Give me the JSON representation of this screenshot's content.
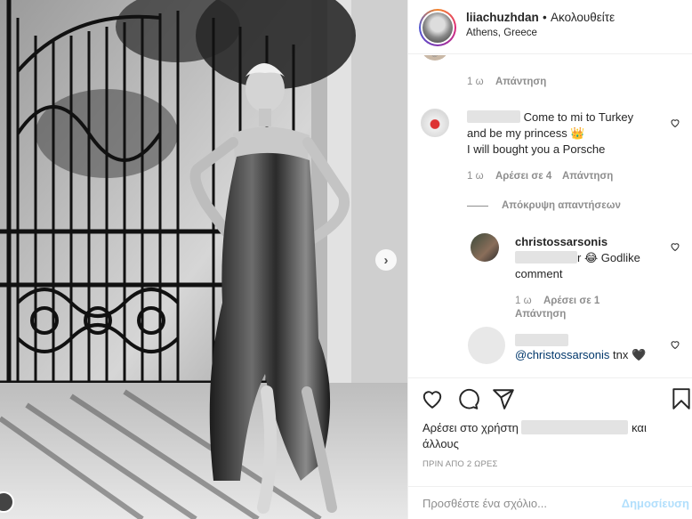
{
  "post": {
    "username": "liiachuzhdan",
    "dot": "•",
    "follow_label": "Ακολουθείτε",
    "location": "Athens, Greece"
  },
  "comments": {
    "top_reply": {
      "time": "1 ω",
      "reply_label": "Απάντηση"
    },
    "c1": {
      "text_line1": "Come to mi to Turkey",
      "text_line2": "and be my princess 👑",
      "text_line3": "I will bought you a Porsche",
      "time": "1 ω",
      "likes": "Αρέσει σε 4",
      "reply_label": "Απάντηση"
    },
    "hide_replies": "Απόκρυψη απαντήσεων",
    "r1": {
      "username": "christossarsonis",
      "text_suffix": "r 😂 Godlike",
      "text_line2": "comment",
      "time": "1 ω",
      "likes": "Αρέσει σε 1",
      "reply_label": "Απάντηση"
    },
    "r2": {
      "mention": "@christossarsonis",
      "text": "tnx 🖤"
    }
  },
  "actions": {
    "likes_prefix": "Αρέσει στο χρήστη",
    "likes_and": "και",
    "likes_others": "άλλους",
    "time_ago": "ΠΡΙΝ ΑΠΟ 2 ΩΡΕΣ"
  },
  "comment_box": {
    "placeholder": "Προσθέστε ένα σχόλιο...",
    "post_label": "Δημοσίευση"
  },
  "photo": {
    "next_icon": "chevron-right-icon"
  },
  "colors": {
    "muted": "#8e8e8e",
    "text": "#262626",
    "post_disabled": "#b2dffc",
    "border": "#efefef"
  }
}
